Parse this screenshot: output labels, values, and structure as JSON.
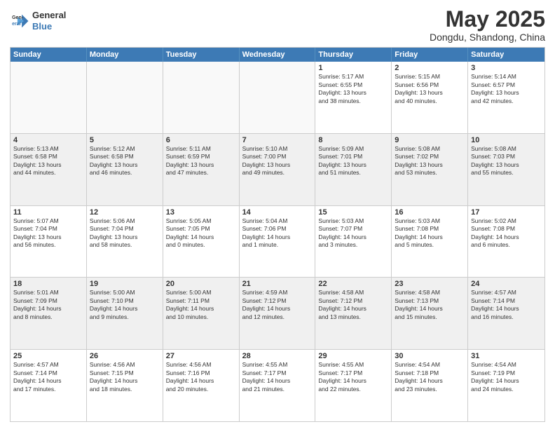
{
  "header": {
    "logo_line1": "General",
    "logo_line2": "Blue",
    "month_year": "May 2025",
    "location": "Dongdu, Shandong, China"
  },
  "days_of_week": [
    "Sunday",
    "Monday",
    "Tuesday",
    "Wednesday",
    "Thursday",
    "Friday",
    "Saturday"
  ],
  "weeks": [
    [
      {
        "day": "",
        "text": "",
        "empty": true
      },
      {
        "day": "",
        "text": "",
        "empty": true
      },
      {
        "day": "",
        "text": "",
        "empty": true
      },
      {
        "day": "",
        "text": "",
        "empty": true
      },
      {
        "day": "1",
        "text": "Sunrise: 5:17 AM\nSunset: 6:55 PM\nDaylight: 13 hours\nand 38 minutes.",
        "empty": false
      },
      {
        "day": "2",
        "text": "Sunrise: 5:15 AM\nSunset: 6:56 PM\nDaylight: 13 hours\nand 40 minutes.",
        "empty": false
      },
      {
        "day": "3",
        "text": "Sunrise: 5:14 AM\nSunset: 6:57 PM\nDaylight: 13 hours\nand 42 minutes.",
        "empty": false
      }
    ],
    [
      {
        "day": "4",
        "text": "Sunrise: 5:13 AM\nSunset: 6:58 PM\nDaylight: 13 hours\nand 44 minutes.",
        "empty": false
      },
      {
        "day": "5",
        "text": "Sunrise: 5:12 AM\nSunset: 6:58 PM\nDaylight: 13 hours\nand 46 minutes.",
        "empty": false
      },
      {
        "day": "6",
        "text": "Sunrise: 5:11 AM\nSunset: 6:59 PM\nDaylight: 13 hours\nand 47 minutes.",
        "empty": false
      },
      {
        "day": "7",
        "text": "Sunrise: 5:10 AM\nSunset: 7:00 PM\nDaylight: 13 hours\nand 49 minutes.",
        "empty": false
      },
      {
        "day": "8",
        "text": "Sunrise: 5:09 AM\nSunset: 7:01 PM\nDaylight: 13 hours\nand 51 minutes.",
        "empty": false
      },
      {
        "day": "9",
        "text": "Sunrise: 5:08 AM\nSunset: 7:02 PM\nDaylight: 13 hours\nand 53 minutes.",
        "empty": false
      },
      {
        "day": "10",
        "text": "Sunrise: 5:08 AM\nSunset: 7:03 PM\nDaylight: 13 hours\nand 55 minutes.",
        "empty": false
      }
    ],
    [
      {
        "day": "11",
        "text": "Sunrise: 5:07 AM\nSunset: 7:04 PM\nDaylight: 13 hours\nand 56 minutes.",
        "empty": false
      },
      {
        "day": "12",
        "text": "Sunrise: 5:06 AM\nSunset: 7:04 PM\nDaylight: 13 hours\nand 58 minutes.",
        "empty": false
      },
      {
        "day": "13",
        "text": "Sunrise: 5:05 AM\nSunset: 7:05 PM\nDaylight: 14 hours\nand 0 minutes.",
        "empty": false
      },
      {
        "day": "14",
        "text": "Sunrise: 5:04 AM\nSunset: 7:06 PM\nDaylight: 14 hours\nand 1 minute.",
        "empty": false
      },
      {
        "day": "15",
        "text": "Sunrise: 5:03 AM\nSunset: 7:07 PM\nDaylight: 14 hours\nand 3 minutes.",
        "empty": false
      },
      {
        "day": "16",
        "text": "Sunrise: 5:03 AM\nSunset: 7:08 PM\nDaylight: 14 hours\nand 5 minutes.",
        "empty": false
      },
      {
        "day": "17",
        "text": "Sunrise: 5:02 AM\nSunset: 7:08 PM\nDaylight: 14 hours\nand 6 minutes.",
        "empty": false
      }
    ],
    [
      {
        "day": "18",
        "text": "Sunrise: 5:01 AM\nSunset: 7:09 PM\nDaylight: 14 hours\nand 8 minutes.",
        "empty": false
      },
      {
        "day": "19",
        "text": "Sunrise: 5:00 AM\nSunset: 7:10 PM\nDaylight: 14 hours\nand 9 minutes.",
        "empty": false
      },
      {
        "day": "20",
        "text": "Sunrise: 5:00 AM\nSunset: 7:11 PM\nDaylight: 14 hours\nand 10 minutes.",
        "empty": false
      },
      {
        "day": "21",
        "text": "Sunrise: 4:59 AM\nSunset: 7:12 PM\nDaylight: 14 hours\nand 12 minutes.",
        "empty": false
      },
      {
        "day": "22",
        "text": "Sunrise: 4:58 AM\nSunset: 7:12 PM\nDaylight: 14 hours\nand 13 minutes.",
        "empty": false
      },
      {
        "day": "23",
        "text": "Sunrise: 4:58 AM\nSunset: 7:13 PM\nDaylight: 14 hours\nand 15 minutes.",
        "empty": false
      },
      {
        "day": "24",
        "text": "Sunrise: 4:57 AM\nSunset: 7:14 PM\nDaylight: 14 hours\nand 16 minutes.",
        "empty": false
      }
    ],
    [
      {
        "day": "25",
        "text": "Sunrise: 4:57 AM\nSunset: 7:14 PM\nDaylight: 14 hours\nand 17 minutes.",
        "empty": false
      },
      {
        "day": "26",
        "text": "Sunrise: 4:56 AM\nSunset: 7:15 PM\nDaylight: 14 hours\nand 18 minutes.",
        "empty": false
      },
      {
        "day": "27",
        "text": "Sunrise: 4:56 AM\nSunset: 7:16 PM\nDaylight: 14 hours\nand 20 minutes.",
        "empty": false
      },
      {
        "day": "28",
        "text": "Sunrise: 4:55 AM\nSunset: 7:17 PM\nDaylight: 14 hours\nand 21 minutes.",
        "empty": false
      },
      {
        "day": "29",
        "text": "Sunrise: 4:55 AM\nSunset: 7:17 PM\nDaylight: 14 hours\nand 22 minutes.",
        "empty": false
      },
      {
        "day": "30",
        "text": "Sunrise: 4:54 AM\nSunset: 7:18 PM\nDaylight: 14 hours\nand 23 minutes.",
        "empty": false
      },
      {
        "day": "31",
        "text": "Sunrise: 4:54 AM\nSunset: 7:19 PM\nDaylight: 14 hours\nand 24 minutes.",
        "empty": false
      }
    ]
  ]
}
